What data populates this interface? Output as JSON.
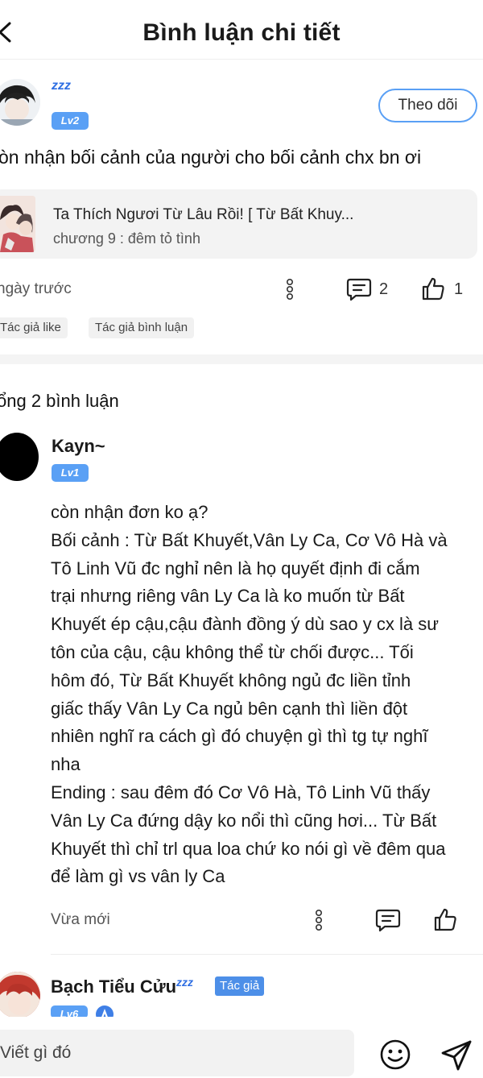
{
  "header": {
    "title": "Bình luận chi tiết"
  },
  "post": {
    "zzz": "zzz",
    "level": "Lv2",
    "follow_label": "Theo dõi",
    "text": "òn nhận bối cảnh của người cho bối cảnh chx bn ơi",
    "chapter": {
      "title": "Ta Thích Ngươi Từ Lâu Rồi! [ Từ Bất Khuy...",
      "subtitle": "chương 9 : đêm tỏ tình"
    },
    "time": "ngày trước",
    "comment_count": "2",
    "like_count": "1",
    "tags": [
      "Tác giả like",
      "Tác giả bình luận"
    ]
  },
  "comments_header": {
    "total": "ổng 2 bình luận"
  },
  "comments": [
    {
      "name": "Kayn~",
      "level": "Lv1",
      "lines": [
        "còn nhận đơn ko ạ?",
        "Bối cảnh : Từ Bất Khuyết,Vân Ly Ca, Cơ Vô Hà và",
        "Tô Linh Vũ đc nghỉ nên là họ quyết định đi cắm",
        "trại nhưng riêng vân Ly Ca là ko muốn từ Bất",
        "Khuyết ép cậu,cậu đành đồng ý dù sao y cx là sư",
        "tôn của cậu, cậu không thể từ chối được... Tối",
        "hôm đó, Từ Bất Khuyết không ngủ đc liền tỉnh",
        "giấc thấy Vân Ly Ca ngủ bên cạnh thì liền đột",
        "nhiên nghĩ ra cách gì đó chuyện gì thì tg tự nghĩ",
        "nha",
        "Ending : sau đêm đó Cơ Vô Hà, Tô Linh Vũ thấy",
        "Vân Ly Ca đứng dậy ko nổi thì cũng hơi... Từ Bất",
        "Khuyết thì chỉ trl qua loa chứ ko nói gì về đêm qua",
        "để làm gì vs vân ly Ca"
      ],
      "time": "Vừa mới"
    },
    {
      "name": "Bạch Tiểu Cửu",
      "zzz": "zzz",
      "author_badge": "Tác giả",
      "level": "Lv6"
    }
  ],
  "input": {
    "placeholder": "Viết gì đó"
  },
  "icons": {
    "back": "chevron-left-icon",
    "more": "more-vertical-icon",
    "comment": "comment-icon",
    "like": "thumbs-up-icon",
    "emoji": "smile-icon",
    "send": "send-icon"
  },
  "colors": {
    "accent": "#5aa0f5",
    "author_badge": "#4d8fe8",
    "zzz": "#2f6fe3"
  }
}
